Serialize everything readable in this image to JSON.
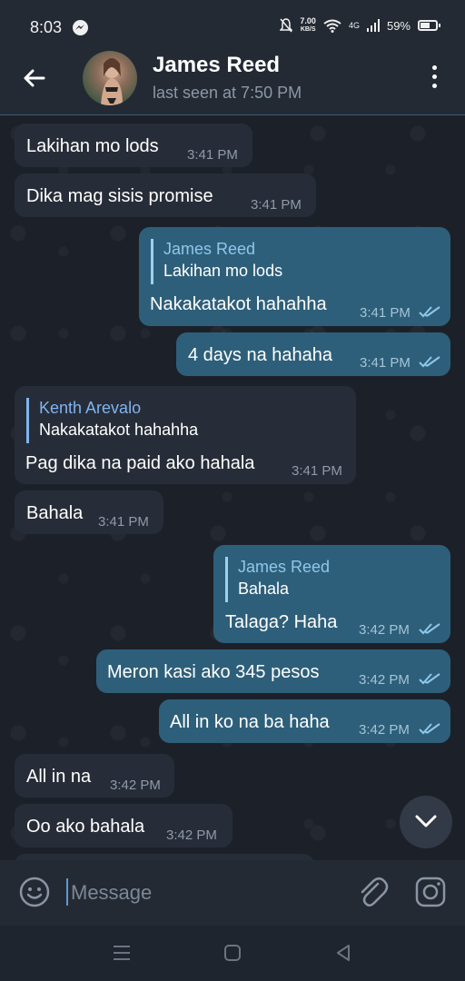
{
  "status_bar": {
    "time": "8:03",
    "net_speed_value": "7.00",
    "net_speed_unit": "KB/S",
    "signal": "4G",
    "battery": "59%"
  },
  "header": {
    "title": "James Reed",
    "subtitle": "last seen at 7:50 PM"
  },
  "messages": {
    "m1": {
      "text": "Lakihan mo lods",
      "time": "3:41 PM"
    },
    "m2": {
      "text": "Dika mag sisis promise",
      "time": "3:41 PM"
    },
    "m3": {
      "reply_name": "James Reed",
      "reply_text": "Lakihan mo lods",
      "text": "Nakakatakot hahahha",
      "time": "3:41 PM"
    },
    "m4": {
      "text": "4 days na hahaha",
      "time": "3:41 PM"
    },
    "m5": {
      "reply_name": "Kenth Arevalo",
      "reply_text": "Nakakatakot hahahha",
      "text": "Pag dika na paid ako hahala",
      "time": "3:41 PM"
    },
    "m6": {
      "text": "Bahala",
      "time": "3:41 PM"
    },
    "m7": {
      "reply_name": "James Reed",
      "reply_text": "Bahala",
      "text": "Talaga? Haha",
      "time": "3:42 PM"
    },
    "m8": {
      "text": "Meron kasi ako 345 pesos",
      "time": "3:42 PM"
    },
    "m9": {
      "text": "All in ko na ba haha",
      "time": "3:42 PM"
    },
    "m10": {
      "text": "All in na",
      "time": "3:42 PM"
    },
    "m11": {
      "text": "Oo ako bahala",
      "time": "3:42 PM"
    }
  },
  "input": {
    "placeholder": "Message"
  },
  "colors": {
    "background": "#1c2129",
    "bubble_in": "#272d38",
    "bubble_out": "#2e5f7a",
    "accent": "#7fb4f0"
  },
  "icons": [
    "back-arrow-icon",
    "more-vert-icon",
    "double-check-icon",
    "chevron-down-icon",
    "emoji-icon",
    "attach-icon",
    "camera-icon",
    "messenger-icon"
  ]
}
